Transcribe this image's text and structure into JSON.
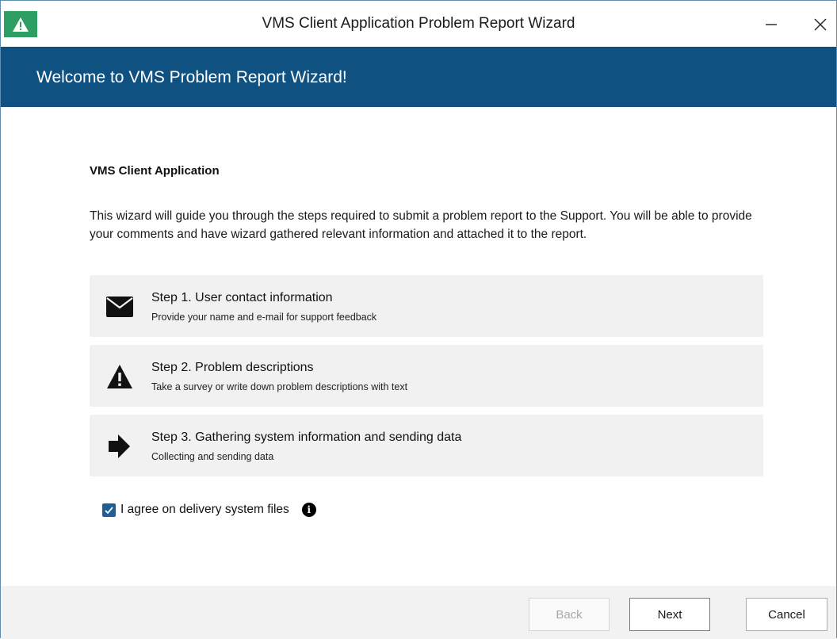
{
  "window": {
    "title": "VMS Client Application Problem Report Wizard",
    "minimize_glyph": "—",
    "close_glyph": "✕",
    "accent_color": "#0f5282",
    "app_icon": "warning-triangle-icon"
  },
  "header": {
    "title": "Welcome to VMS Problem Report Wizard!"
  },
  "main": {
    "section_title": "VMS Client Application",
    "intro": "This wizard will guide you through the steps required to submit a problem report to the Support. You will be able to provide your comments and have wizard gathered relevant information and attached it to the report.",
    "steps": [
      {
        "icon": "envelope-icon",
        "title": "Step 1. User contact information",
        "description": "Provide your name and e-mail for support feedback"
      },
      {
        "icon": "warning-triangle-icon",
        "title": "Step 2. Problem descriptions",
        "description": "Take a survey or write down problem descriptions with text"
      },
      {
        "icon": "arrow-right-icon",
        "title": "Step 3. Gathering system information and sending data",
        "description": "Collecting and sending data"
      }
    ],
    "agree": {
      "checked": true,
      "label": "I agree on delivery system files",
      "info_glyph": "i"
    }
  },
  "footer": {
    "back_label": "Back",
    "back_enabled": false,
    "next_label": "Next",
    "cancel_label": "Cancel"
  }
}
